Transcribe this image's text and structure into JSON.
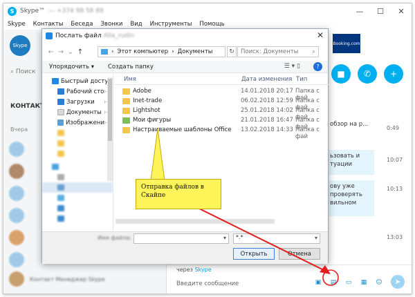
{
  "window": {
    "title": "Skype™",
    "title_blur": "— +374 98 58 88",
    "controls": [
      "—",
      "☐",
      "✕"
    ]
  },
  "menu": [
    "Skype",
    "Контакты",
    "Беседа",
    "Звонки",
    "Вид",
    "Инструменты",
    "Помощь"
  ],
  "sidebar": {
    "avatar_text": "Skype",
    "search": "Поиск",
    "contacts_tab": "КОНТАКТЫ",
    "yesterday": "Вчера",
    "rows": [
      "",
      "",
      "",
      "",
      "",
      "",
      "",
      "",
      "Контакт Менеджер Skype",
      ""
    ]
  },
  "chat": {
    "booking": "Booking.com",
    "messages": [
      {
        "text": "обзор на р...",
        "time": "0:49"
      },
      {
        "text": "ьзовать и\nтуации",
        "time": "10:07"
      },
      {
        "text": "ову уже\nпроверять\nвильном",
        "time": "10:13"
      },
      {
        "text": "",
        "time": "13:03"
      }
    ],
    "via": "через",
    "via_brand": "Skype",
    "placeholder": "Введите сообщение",
    "send_icon": "send-icon"
  },
  "dialog": {
    "title": "Послать файл",
    "title_blur": "Alla_rudin",
    "address": [
      "Этот компьютер",
      "Документы"
    ],
    "search_placeholder": "Поиск: Документы",
    "organize": "Упорядочить ▾",
    "new_folder": "Создать папку",
    "tree": [
      {
        "label": "Быстрый доступ",
        "color": "#1e88e5",
        "pin": ""
      },
      {
        "label": "Рабочий сто",
        "color": "#2a7fd4",
        "pin": "📌"
      },
      {
        "label": "Загрузки",
        "color": "#2a7fd4",
        "pin": "📌"
      },
      {
        "label": "Документы",
        "color": "#e0e0e0",
        "pin": "📌"
      },
      {
        "label": "Изображени",
        "color": "#5a9fd6",
        "pin": "📌"
      }
    ],
    "columns": {
      "name": "Имя",
      "date": "Дата изменения",
      "type": "Тип"
    },
    "files": [
      {
        "name": "Adobe",
        "date": "14.01.2018 20:17",
        "type": "Папка с фай"
      },
      {
        "name": "Inet-trade",
        "date": "06.02.2018 12:59",
        "type": "Папка с фай"
      },
      {
        "name": "Lightshot",
        "date": "25.01.2018 14:02",
        "type": "Папка с фай"
      },
      {
        "name": "Мои фигуры",
        "date": "21.01.2018 16:47",
        "type": "Папка с фай"
      },
      {
        "name": "Настраиваемые шаблоны Office",
        "date": "13.02.2018 14:33",
        "type": "Папка с фай"
      }
    ],
    "file_type": "*.*",
    "open": "Открыть",
    "cancel": "Отмена"
  },
  "annotation": {
    "callout_text": "Отправка файлов в Скайпе",
    "callout_color": "#fff55a",
    "arrow_color": "#e31b1b"
  }
}
